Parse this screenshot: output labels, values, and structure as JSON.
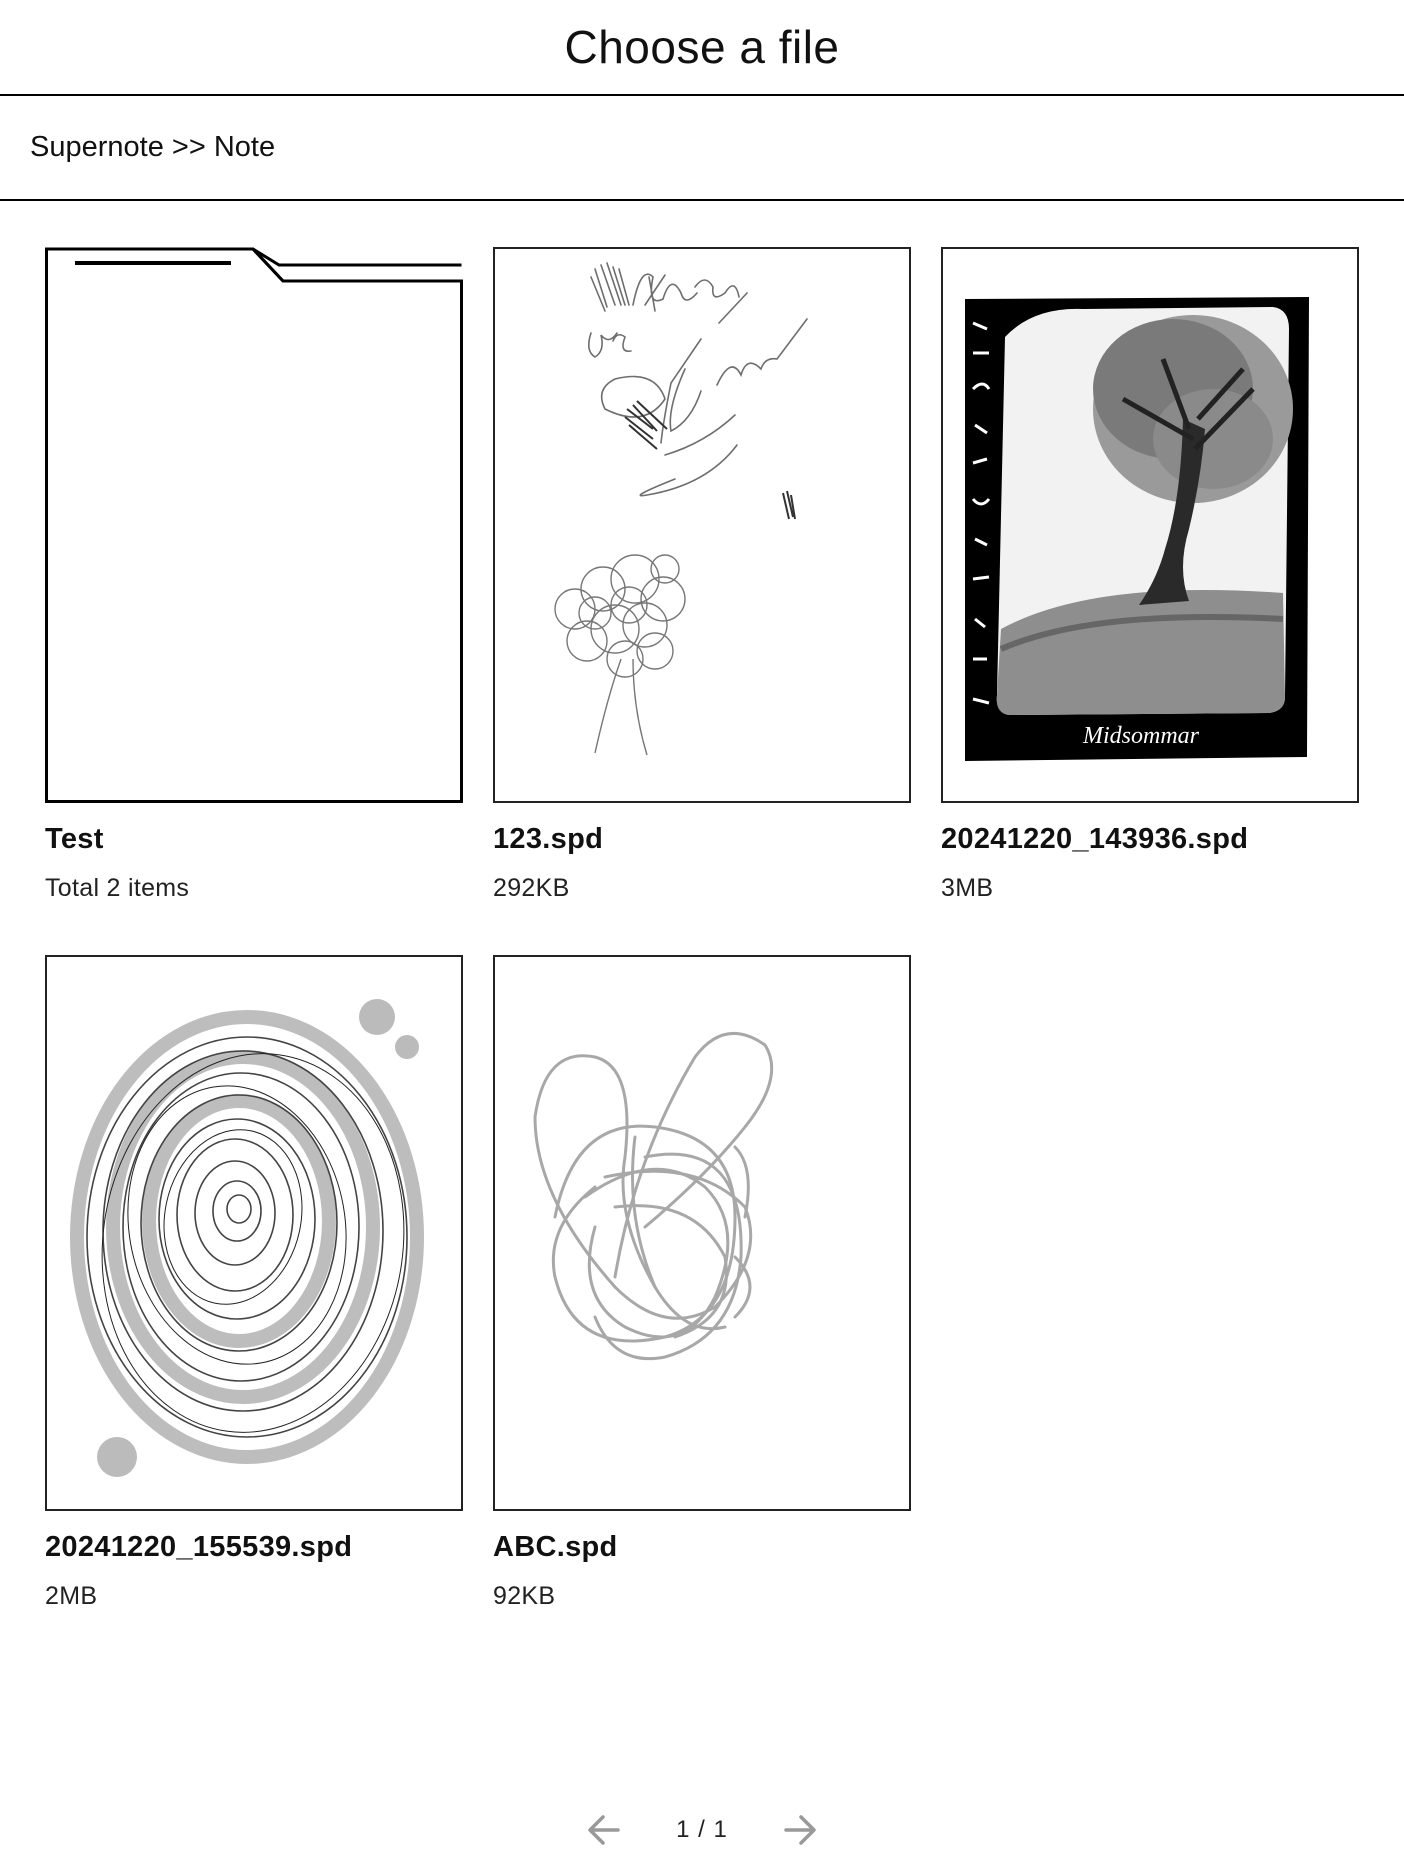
{
  "header": {
    "title": "Choose a file"
  },
  "breadcrumb": {
    "path": "Supernote >> Note"
  },
  "files": [
    {
      "name": "Test",
      "meta": "Total 2 items",
      "kind": "folder"
    },
    {
      "name": "123.spd",
      "meta": "292KB",
      "kind": "file"
    },
    {
      "name": "20241220_143936.spd",
      "meta": "3MB",
      "kind": "file",
      "thumbnail_text": "Midsommar"
    },
    {
      "name": "20241220_155539.spd",
      "meta": "2MB",
      "kind": "file"
    },
    {
      "name": "ABC.spd",
      "meta": "92KB",
      "kind": "file"
    }
  ],
  "pagination": {
    "indicator": "1 / 1",
    "prev_icon": "arrow-left-icon",
    "next_icon": "arrow-right-icon"
  }
}
